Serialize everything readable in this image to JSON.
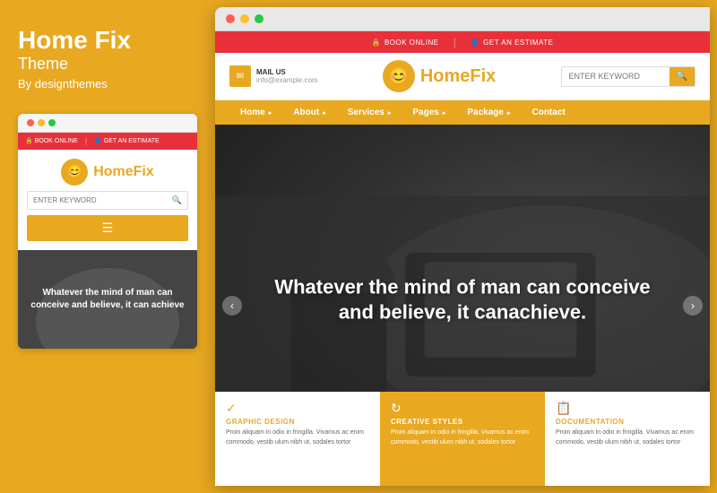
{
  "left": {
    "title": "Home Fix",
    "subtitle": "Theme",
    "author": "By designthemes",
    "mobile": {
      "dots": [
        "red",
        "yellow",
        "green"
      ],
      "topbar": {
        "book": "BOOK ONLINE",
        "estimate": "GET AN ESTIMATE"
      },
      "logo": "HomeFix",
      "logo_part1": "Home",
      "search_placeholder": "ENTER KEYWORD",
      "hero_text": "Whatever the mind of man can conceive and believe, it can achieve"
    }
  },
  "right": {
    "browser_dots": [
      "red",
      "yellow",
      "green"
    ],
    "topbar": {
      "book": "BOOK ONLINE",
      "estimate": "GET AN ESTIMATE"
    },
    "header": {
      "mail_label": "MAIL US",
      "mail_address": "info@example.com",
      "logo_part1": "Home",
      "logo_part2": "Fix",
      "search_placeholder": "ENTER KEYWORD"
    },
    "nav": {
      "items": [
        "Home",
        "About",
        "Services",
        "Pages",
        "Package",
        "Contact"
      ]
    },
    "hero": {
      "heading": "Whatever the mind of man can conceive and believe, it canachieve."
    },
    "cards": [
      {
        "icon": "✓",
        "title": "GRAPHIC DESIGN",
        "body": "Proin aliquam in odio in fringilla. Vivamus ac enim commodo, vestib ulum nibh ut, sodales tortor"
      },
      {
        "icon": "↻",
        "title": "CREATIVE STYLES",
        "body": "Proin aliquam in odio in fringilla. Vivamus ac enim commodo, vestib ulum nibh ut, sodales tortor",
        "type": "orange"
      },
      {
        "icon": "📋",
        "title": "DOCUMENTATION",
        "body": "Proin aliquam in odio in fringilla. Vivamus ac enim commodo, vestib ulum nibh ut, sodales tortor"
      }
    ]
  },
  "colors": {
    "accent": "#E8A820",
    "red": "#E8303A",
    "white": "#ffffff",
    "dark": "#333333"
  }
}
